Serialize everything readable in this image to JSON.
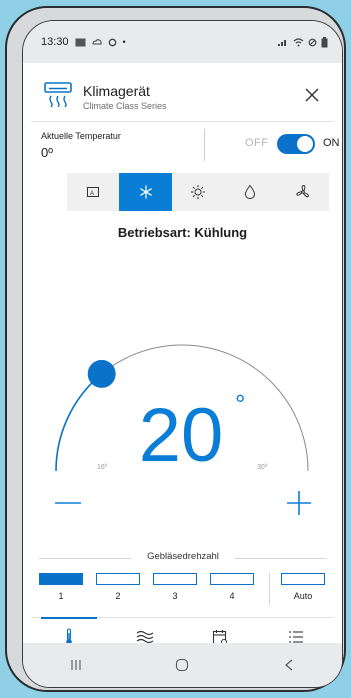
{
  "status_bar": {
    "time": "13:30",
    "icons": [
      "image-icon",
      "cloud-icon",
      "settings-icon",
      "dot-icon"
    ],
    "right_icons": [
      "signal-icon",
      "wifi-icon",
      "alarm-icon",
      "battery-icon"
    ]
  },
  "header": {
    "title": "Klimagerät",
    "subtitle": "Climate Class Series"
  },
  "temperature": {
    "label": "Aktuelle Temperatur",
    "value": "0º"
  },
  "power": {
    "off_label": "OFF",
    "on_label": "ON",
    "state": "on"
  },
  "modes": [
    {
      "icon": "auto-mode-icon",
      "active": false
    },
    {
      "icon": "snowflake-icon",
      "active": true
    },
    {
      "icon": "sun-icon",
      "active": false
    },
    {
      "icon": "droplet-icon",
      "active": false
    },
    {
      "icon": "fan-icon",
      "active": false
    }
  ],
  "mode_text": "Betriebsart: Kühlung",
  "setpoint": {
    "value": "20",
    "unit": "°",
    "min_label": "16º",
    "max_label": "30º",
    "level": 0.28
  },
  "fan": {
    "title": "Gebläsedrehzahl",
    "speeds": [
      "1",
      "2",
      "3",
      "4"
    ],
    "auto_label": "Auto",
    "selected": "1"
  },
  "tabs": [
    {
      "icon": "thermometer-icon",
      "active": true
    },
    {
      "icon": "airflow-icon",
      "active": false
    },
    {
      "icon": "calendar-icon",
      "active": false
    },
    {
      "icon": "list-icon",
      "active": false
    }
  ],
  "colors": {
    "accent": "#0a73c9",
    "mode_active": "#0a7ed6",
    "background": "#8fd0e6"
  }
}
